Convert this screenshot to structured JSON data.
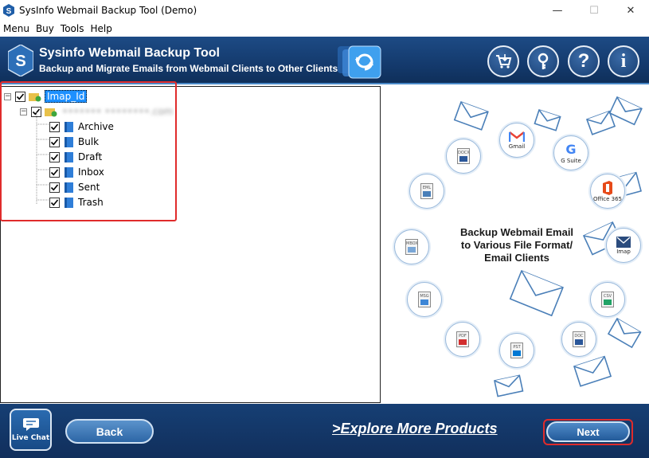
{
  "window": {
    "title": "SysInfo Webmail Backup Tool (Demo)",
    "controls": {
      "minimize": "—",
      "maximize": "☐",
      "close": "✕"
    }
  },
  "menu": [
    "Menu",
    "Buy",
    "Tools",
    "Help"
  ],
  "header": {
    "title": "Sysinfo Webmail Backup Tool",
    "subtitle": "Backup and Migrate Emails from Webmail Clients to Other Clients",
    "logo_letter": "S",
    "buttons": [
      {
        "name": "cart-icon",
        "glyph": "🛒"
      },
      {
        "name": "key-icon",
        "glyph": "⚷"
      },
      {
        "name": "help-icon",
        "glyph": "?"
      },
      {
        "name": "info-icon",
        "glyph": "i"
      }
    ]
  },
  "tree": {
    "root": {
      "label": "Imap_Id",
      "checked": true
    },
    "account": {
      "label": "••••••• ••••••••.com",
      "checked": true
    },
    "folders": [
      {
        "label": "Archive",
        "checked": true
      },
      {
        "label": "Bulk",
        "checked": true
      },
      {
        "label": "Draft",
        "checked": true
      },
      {
        "label": "Inbox",
        "checked": true
      },
      {
        "label": "Sent",
        "checked": true
      },
      {
        "label": "Trash",
        "checked": true
      }
    ]
  },
  "illustration": {
    "caption_line1": "Backup Webmail Email",
    "caption_line2": "to Various File Format/",
    "caption_line3": "Email Clients",
    "badges": {
      "docx": "DOCX",
      "gmail": "Gmail",
      "gsuite": "G Suite",
      "eml": "EML",
      "office365": "Office 365",
      "mbox": "MBOX",
      "imap": "Imap",
      "msg": "MSG",
      "csv": "CSV",
      "pdf": "PDF",
      "doc": "DOC",
      "pst": "PST"
    }
  },
  "footer": {
    "live_chat": "Live Chat",
    "back": "Back",
    "explore": ">Explore More Products",
    "next": "Next"
  },
  "colors": {
    "header_bg": "#143a6d",
    "highlight_frame": "#e02b2b",
    "tree_selection": "#1e90ff"
  }
}
